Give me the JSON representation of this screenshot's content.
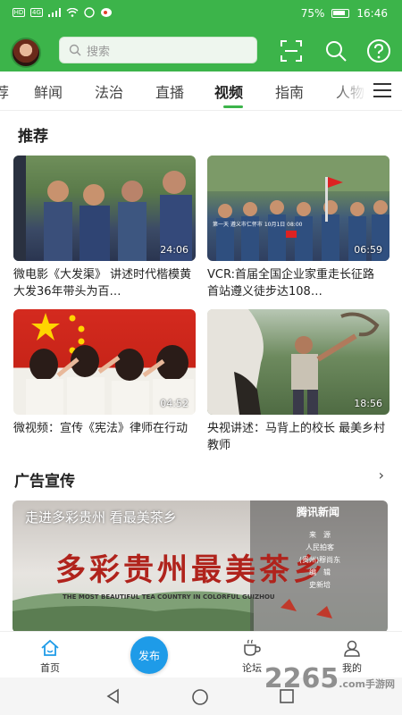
{
  "status_bar": {
    "net_left": "HD",
    "net_4g": "4G",
    "battery": "75%",
    "time": "16:46"
  },
  "header": {
    "search_placeholder": "搜索"
  },
  "tabs": [
    "荐",
    "鲜闻",
    "法治",
    "直播",
    "视频",
    "指南",
    "人物"
  ],
  "active_tab": "视频",
  "sections": {
    "recommend_title": "推荐",
    "ads_title": "广告宣传",
    "more": "›"
  },
  "videos": [
    {
      "title": "微电影《大发渠》 讲述时代楷模黄大发36年带头为百…",
      "duration": "24:06"
    },
    {
      "title": "VCR:首届全国企业家重走长征路 首站遵义徒步达108…",
      "duration": "06:59"
    },
    {
      "title": "微视频：宣传《宪法》律师在行动",
      "duration": "04:52"
    },
    {
      "title": "央视讲述：马背上的校长 最美乡村教师",
      "duration": "18:56"
    }
  ],
  "video_caption_2": "第一天 遵义市仁怀市 10月1日 08:00",
  "banner": {
    "headline": "走进多彩贵州 看最美茶乡",
    "calligraphy": "多彩贵州最美茶乡",
    "english": "THE MOST BEAUTIFUL TEA COUNTRY IN COLORFUL GUIZHOU",
    "news_logo": "腾讯新闻",
    "credits": [
      "来　源",
      "人民拍客",
      "(贵州)穆尚东",
      "编　辑",
      "史新培"
    ]
  },
  "bottom_nav": {
    "home": "首页",
    "publish": "发布",
    "forum": "论坛",
    "mine": "我的"
  },
  "watermark": {
    "number": "2265",
    "site": ".com",
    "label": "手游网"
  },
  "colors": {
    "brand_green": "#3cb44a",
    "publish_blue": "#1e9be8"
  }
}
